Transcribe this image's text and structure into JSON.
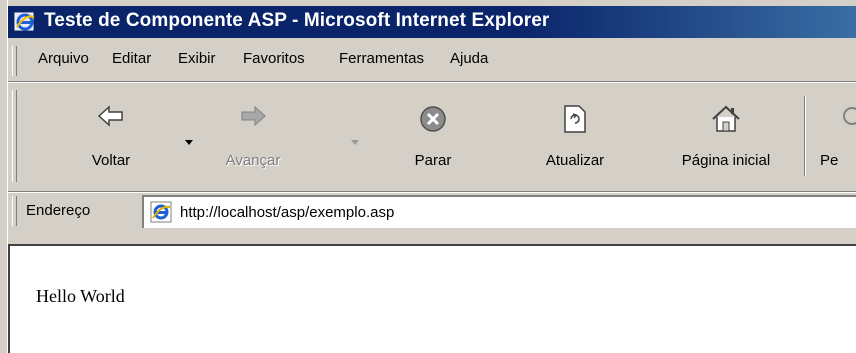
{
  "window": {
    "title": "Teste de Componente ASP - Microsoft Internet Explorer",
    "title_icon": "ie-logo-icon"
  },
  "menu": [
    {
      "label": "Arquivo"
    },
    {
      "label": "Editar"
    },
    {
      "label": "Exibir"
    },
    {
      "label": "Favoritos"
    },
    {
      "label": "Ferramentas"
    },
    {
      "label": "Ajuda"
    }
  ],
  "toolbar": {
    "back": {
      "label": "Voltar",
      "icon": "back-arrow-icon"
    },
    "forward": {
      "label": "Avançar",
      "icon": "forward-arrow-icon",
      "disabled": true
    },
    "stop": {
      "label": "Parar",
      "icon": "stop-icon"
    },
    "refresh": {
      "label": "Atualizar",
      "icon": "refresh-icon"
    },
    "home": {
      "label": "Página inicial",
      "icon": "home-icon"
    },
    "search": {
      "label": "Pe",
      "icon": "search-icon"
    }
  },
  "address": {
    "label": "Endereço",
    "url": "http://localhost/asp/exemplo.asp"
  },
  "content": {
    "text": "Hello World"
  },
  "colors": {
    "titlebar": "#0a246a",
    "chrome": "#d4d0c8"
  }
}
